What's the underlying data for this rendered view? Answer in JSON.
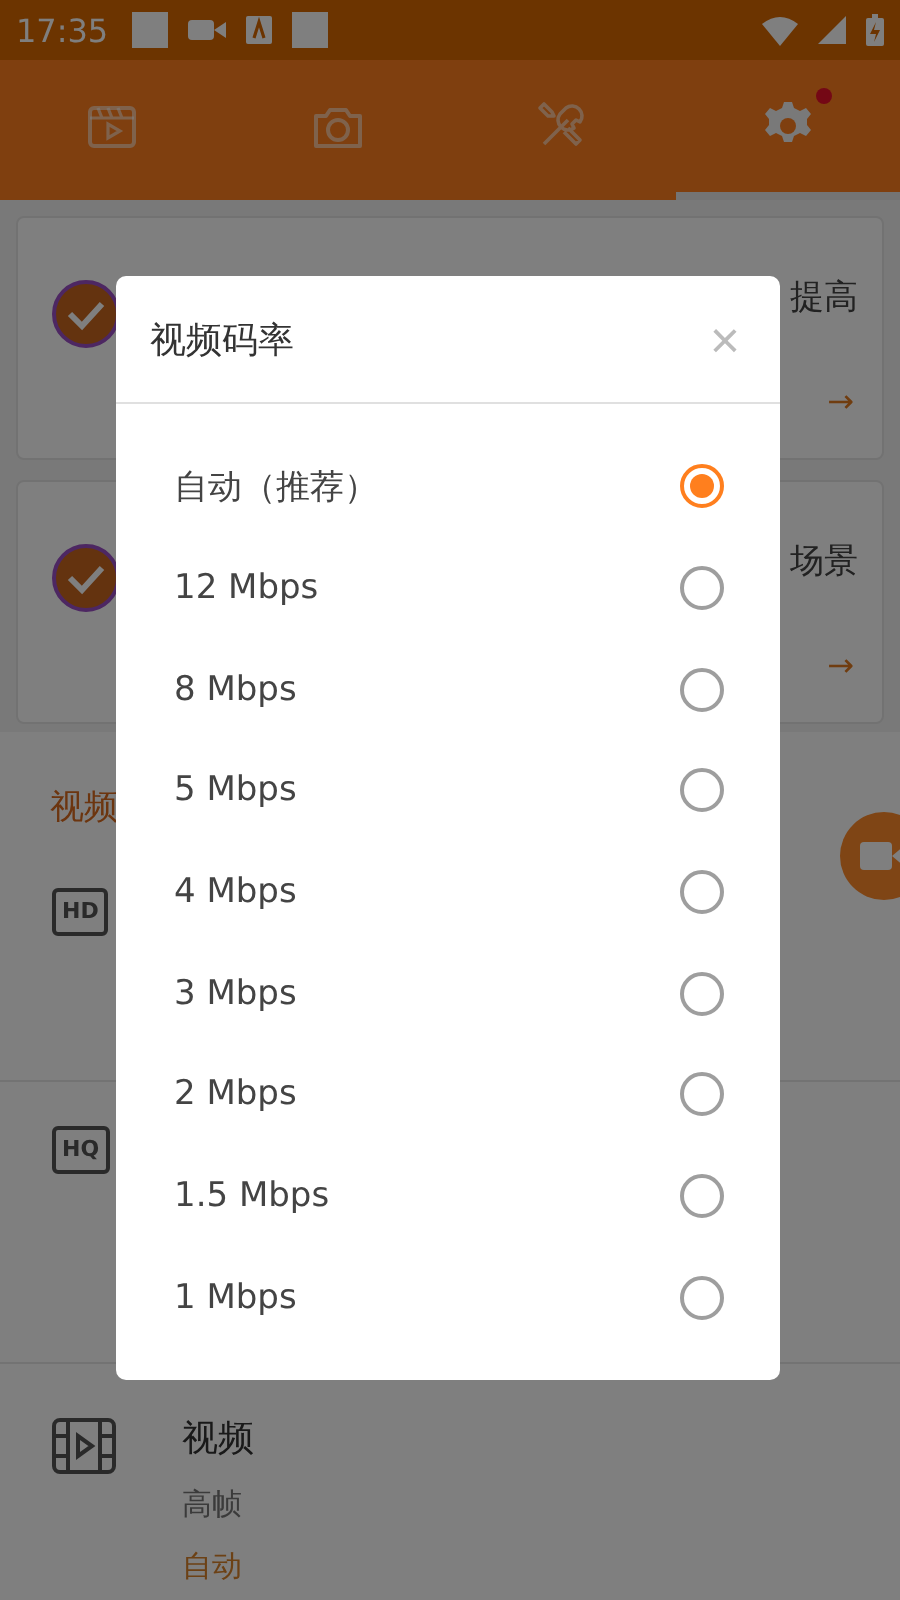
{
  "status_bar": {
    "time": "17:35"
  },
  "tabs": [
    {
      "kind": "video",
      "selected": false,
      "badge": false
    },
    {
      "kind": "camera",
      "selected": false,
      "badge": false
    },
    {
      "kind": "tools",
      "selected": false,
      "badge": false
    },
    {
      "kind": "settings",
      "selected": true,
      "badge": true
    }
  ],
  "cards": [
    {
      "text": "提高",
      "arrow": "→"
    },
    {
      "text": "场景",
      "arrow": "→"
    }
  ],
  "section_title": "视频",
  "settings_rows": [
    {
      "kind": "badge",
      "badge": "HD"
    },
    {
      "kind": "badge",
      "badge": "HQ"
    },
    {
      "kind": "film",
      "title": "视频",
      "subtitle": "高帧",
      "value": "自动"
    }
  ],
  "dialog": {
    "title": "视频码率",
    "close": "×",
    "options": [
      {
        "label": "自动（推荐）",
        "selected": true
      },
      {
        "label": "12 Mbps",
        "selected": false
      },
      {
        "label": "8 Mbps",
        "selected": false
      },
      {
        "label": "5 Mbps",
        "selected": false
      },
      {
        "label": "4 Mbps",
        "selected": false
      },
      {
        "label": "3 Mbps",
        "selected": false
      },
      {
        "label": "2 Mbps",
        "selected": false
      },
      {
        "label": "1.5 Mbps",
        "selected": false
      },
      {
        "label": "1 Mbps",
        "selected": false
      }
    ]
  }
}
